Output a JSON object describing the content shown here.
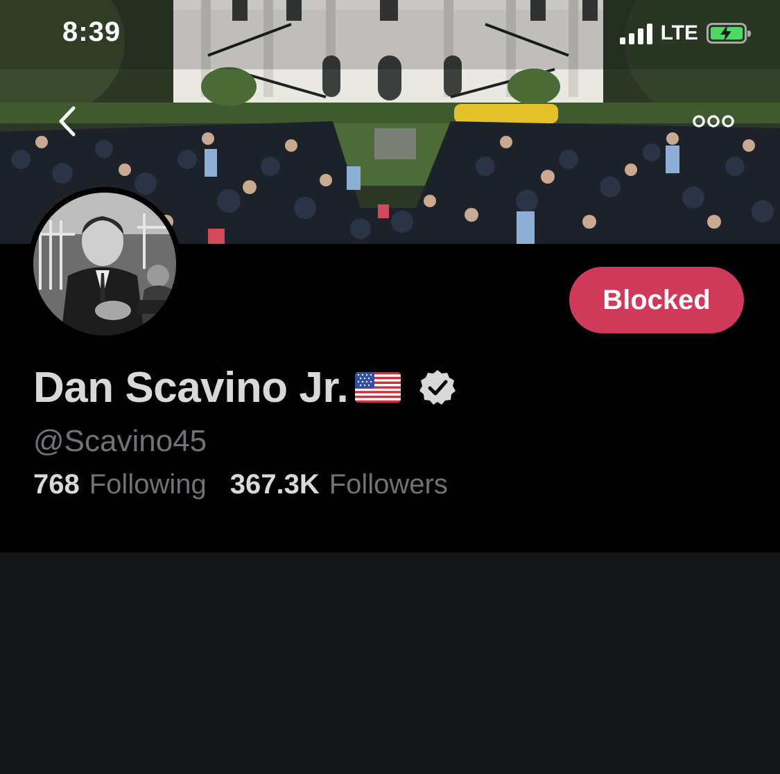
{
  "status_bar": {
    "time": "8:39",
    "network": "LTE",
    "signal_bars": 4,
    "battery_state": "charging"
  },
  "nav": {
    "back_icon": "chevron-left-icon",
    "more_icon": "more-horizontal-icon"
  },
  "profile": {
    "display_name": "Dan Scavino Jr.",
    "flag_icon": "us-flag-icon",
    "verified_icon": "verified-badge-icon",
    "handle": "@Scavino45",
    "following_count": "768",
    "following_label": "Following",
    "followers_count": "367.3K",
    "followers_label": "Followers",
    "action_button_label": "Blocked",
    "action_button_color": "#cf3a5a"
  }
}
